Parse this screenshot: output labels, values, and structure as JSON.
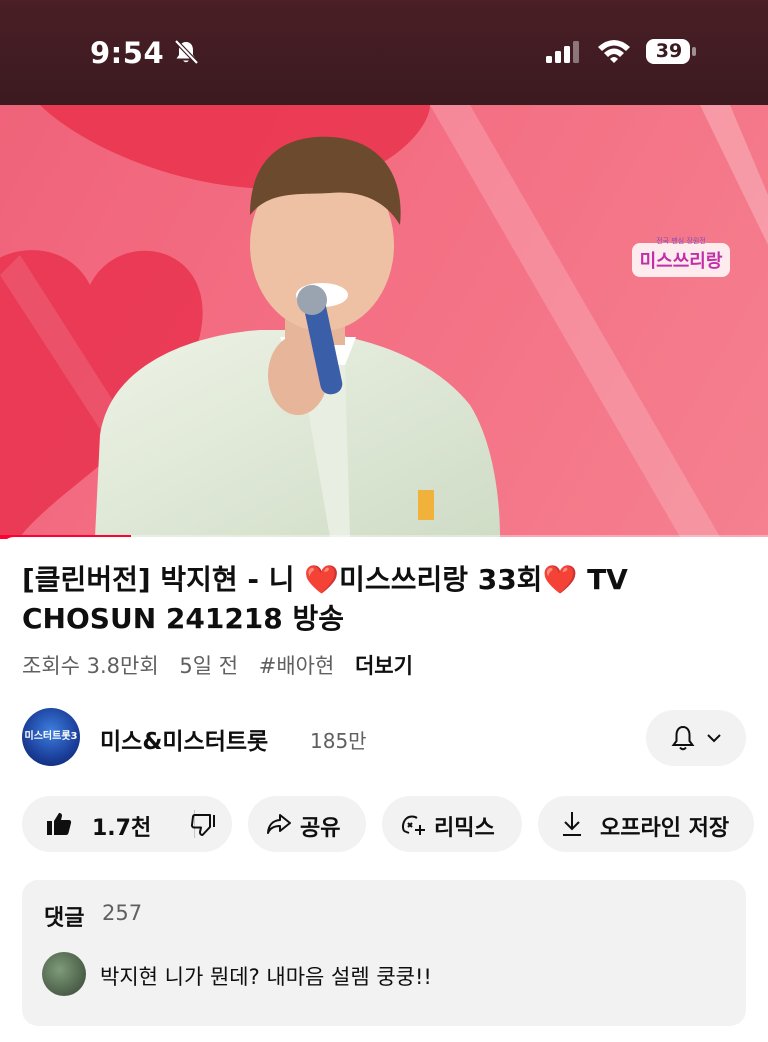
{
  "status_bar": {
    "time": "9:54",
    "battery": "39",
    "icons": [
      "bell-slash-icon",
      "cellular-signal-icon",
      "wifi-icon",
      "battery-icon"
    ]
  },
  "video": {
    "logo_text": "미스쓰리랑",
    "logo_subtext": "전국 팬심 장원전",
    "icons": [
      "show-logo"
    ]
  },
  "details": {
    "title_part1": "[클린버전] 박지현 - 니 ",
    "title_part2": "미스쓰리랑 33회",
    "title_part3": " TV CHOSUN 241218 방송",
    "heart": "❤️",
    "views": "조회수 3.8만회",
    "age": "5일 전",
    "hashtag": "#배아현",
    "more": "더보기"
  },
  "channel": {
    "avatar_text": "미스터트롯3",
    "name": "미스&미스터트롯",
    "subscribers": "185만",
    "icons": [
      "bell-icon",
      "chevron-down-icon"
    ]
  },
  "actions": {
    "like_count": "1.7천",
    "share": "공유",
    "remix": "리믹스",
    "save_offline": "오프라인 저장",
    "icons": [
      "thumbs-up-icon",
      "thumbs-down-icon",
      "share-icon",
      "remix-icon",
      "download-icon"
    ]
  },
  "comments": {
    "title": "댓글",
    "count": "257",
    "top_comment": "박지현 니가 뭔데? 내마음 설렘 쿵쿵!!"
  },
  "colors": {
    "status_bar_bg": "#3b1a20",
    "video_bg": "#f0637a",
    "heart": "#e0192e",
    "pill_bg": "#f2f2f2",
    "progress": "#ff0033"
  },
  "playback": {
    "progress_percent": 17
  }
}
